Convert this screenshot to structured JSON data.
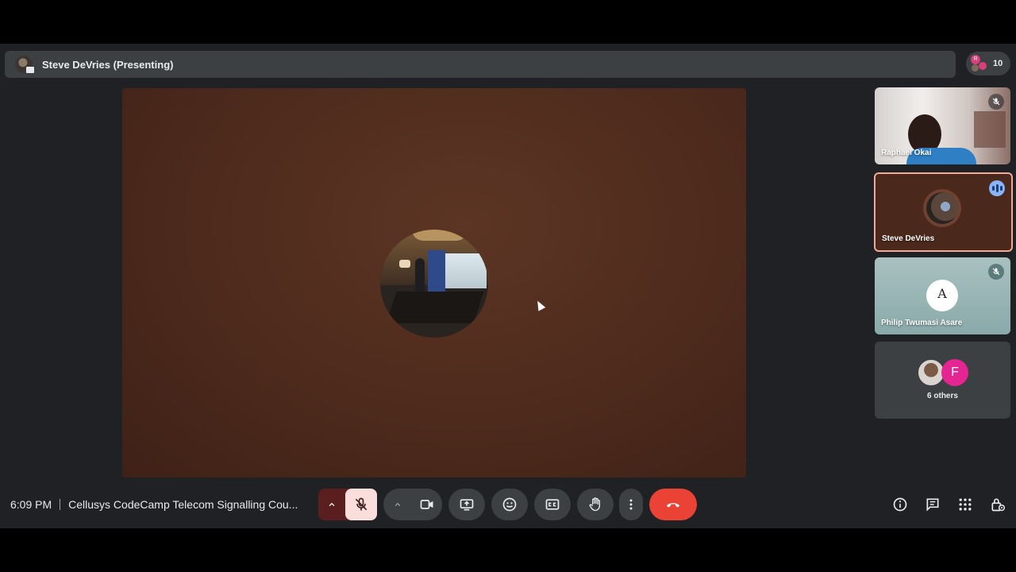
{
  "presenter_bar": {
    "name": "Steve DeVries (Presenting)"
  },
  "people_chip": {
    "count": "10",
    "badge_letter": "R"
  },
  "participants": [
    {
      "name": "Raphael Okai",
      "status": "mic-off"
    },
    {
      "name": "Steve DeVries",
      "status": "speaking"
    },
    {
      "name": "Philip Twumasi Asare",
      "status": "mic-off",
      "avatar_letter": "A"
    },
    {
      "name": "6 others",
      "avatar_letter": "F"
    }
  ],
  "meeting": {
    "time": "6:09 PM",
    "title": "Cellusys CodeCamp Telecom Signalling Cou..."
  },
  "controls": {
    "mic": "mic-off-icon",
    "camera": "videocam-icon",
    "present": "present-screen-icon",
    "reactions": "emoji-icon",
    "captions": "closed-captions-icon",
    "raise_hand": "hand-icon",
    "more": "more-vert-icon",
    "leave": "call-end-icon"
  },
  "right_panel": [
    "info-icon",
    "chat-icon",
    "activities-icon",
    "host-controls-icon"
  ],
  "colors": {
    "leave": "#ea4335",
    "mic_off_bg": "#f9dedc",
    "speaking": "#8ab4f8",
    "others_avatar": "#e52592"
  }
}
